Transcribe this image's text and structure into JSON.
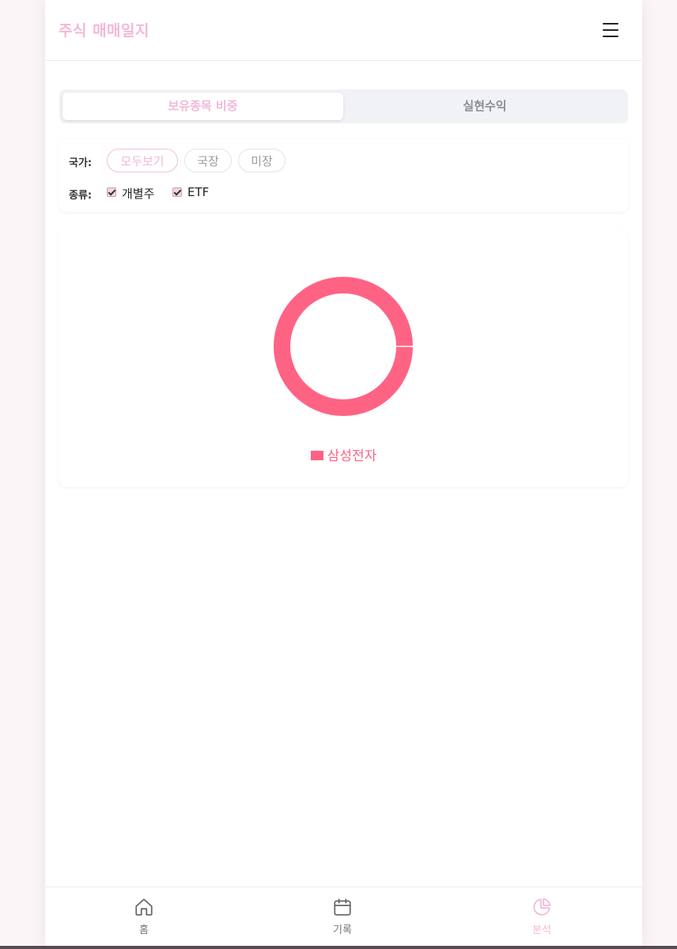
{
  "header": {
    "title": "주식 매매일지",
    "menu_icon": "hamburger-menu-icon"
  },
  "tabs": [
    {
      "label": "보유종목 비중",
      "active": true
    },
    {
      "label": "실현수익",
      "active": false
    }
  ],
  "filters": {
    "country_label": "국가:",
    "country_options": [
      {
        "label": "모두보기",
        "selected": true
      },
      {
        "label": "국장",
        "selected": false
      },
      {
        "label": "미장",
        "selected": false
      }
    ],
    "type_label": "종류:",
    "type_options": [
      {
        "label": "개별주",
        "checked": true
      },
      {
        "label": "ETF",
        "checked": true
      }
    ]
  },
  "chart_data": {
    "type": "pie",
    "categories": [
      "삼성전자"
    ],
    "values": [
      100
    ],
    "colors": [
      "#ff6384"
    ],
    "legend_position": "bottom"
  },
  "bottom_nav": [
    {
      "label": "홈",
      "icon": "home-icon",
      "active": false
    },
    {
      "label": "기록",
      "icon": "calendar-icon",
      "active": false
    },
    {
      "label": "분석",
      "icon": "pie-chart-icon",
      "active": true
    }
  ],
  "colors": {
    "accent": "#f2b8d9",
    "chart": "#ff6384"
  }
}
